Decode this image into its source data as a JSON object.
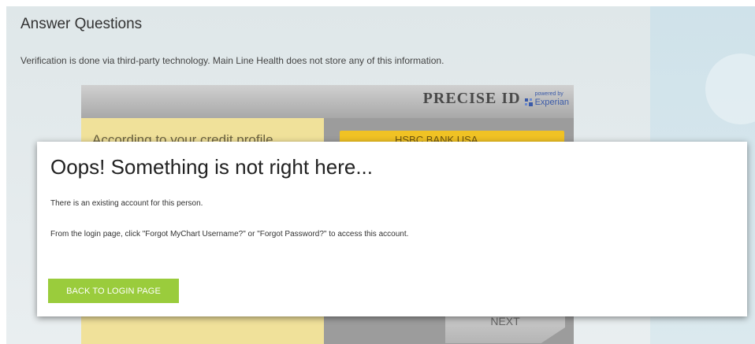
{
  "page": {
    "title": "Answer Questions",
    "subtitle": "Verification is done via third-party technology. Main Line Health does not store any of this information."
  },
  "kba": {
    "brand_name": "PRECISE ID",
    "powered_by": "powered by",
    "brand_partner": "Experian",
    "question": "According to your credit profile",
    "answer_option": "HSBC BANK USA",
    "next_label": "NEXT"
  },
  "modal": {
    "title": "Oops! Something is not right here...",
    "message1": "There is an existing account for this person.",
    "message2": "From the login page, click \"Forgot MyChart Username?\" or \"Forgot Password?\" to access this account.",
    "button_label": "BACK TO LOGIN PAGE"
  },
  "colors": {
    "button_green": "#9acc3c",
    "question_yellow": "#f0e19a",
    "answer_gold": "#f0c224",
    "experian_blue": "#3a5aa8"
  }
}
